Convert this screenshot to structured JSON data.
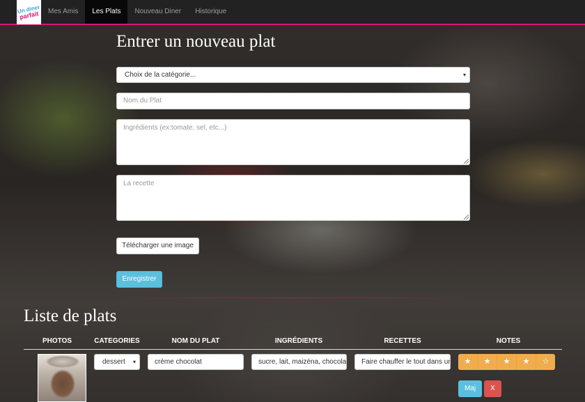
{
  "brand": {
    "line1": "Un diner",
    "line2": "parfait"
  },
  "nav": {
    "items": [
      {
        "label": "Mes Amis"
      },
      {
        "label": "Les Plats"
      },
      {
        "label": "Nouveau Diner"
      },
      {
        "label": "Historique"
      }
    ],
    "active": "Les Plats"
  },
  "form": {
    "title": "Entrer un nouveau plat",
    "category_select": "Choix de la catégorie...",
    "name_placeholder": "Nom du Plat",
    "ingredients_placeholder": "Ingrédients (ex:tomate, sel, etc...)",
    "recipe_placeholder": "La recette",
    "upload_label": "Télécharger une image",
    "save_label": "Enregistrer"
  },
  "list": {
    "title": "Liste de plats",
    "columns": [
      "PHOTOS",
      "CATEGORIES",
      "NOM DU PLAT",
      "INGRÉDIENTS",
      "RECETTES",
      "NOTES"
    ],
    "rows": [
      {
        "category": "dessert",
        "name": "crème chocolat",
        "ingredients": "sucre, lait, maizéna, chocolat",
        "recipe": "Faire chauffer le tout dans une casserole",
        "rating": 4,
        "rating_max": 5,
        "stars": [
          "★",
          "★",
          "★",
          "★",
          "☆"
        ],
        "update_label": "Maj",
        "delete_label": "X"
      }
    ]
  },
  "colors": {
    "accent": "#d6177a",
    "info": "#5bc0de",
    "warning": "#f0ad4e",
    "danger": "#d9534f"
  }
}
